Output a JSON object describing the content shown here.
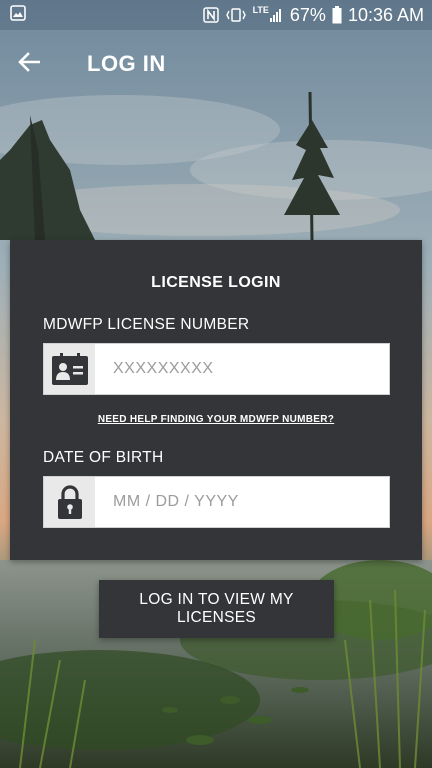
{
  "status_bar": {
    "network": "LTE",
    "battery": "67%",
    "time": "10:36 AM"
  },
  "app_bar": {
    "title": "LOG IN",
    "back_icon": "arrow-left-icon"
  },
  "login_card": {
    "title": "LICENSE LOGIN",
    "license_field": {
      "label": "MDWFP LICENSE NUMBER",
      "placeholder": "XXXXXXXXX",
      "value": "",
      "icon": "id-card-icon"
    },
    "help_link": "NEED HELP FINDING YOUR MDWFP NUMBER?",
    "dob_field": {
      "label": "DATE OF BIRTH",
      "placeholder": "MM / DD / YYYY",
      "value": "",
      "icon": "lock-icon"
    }
  },
  "submit_button": {
    "label": "LOG IN TO VIEW MY LICENSES"
  },
  "colors": {
    "card_background": "#343538",
    "field_icon_background": "#e9e9e9",
    "text": "#ffffff"
  }
}
